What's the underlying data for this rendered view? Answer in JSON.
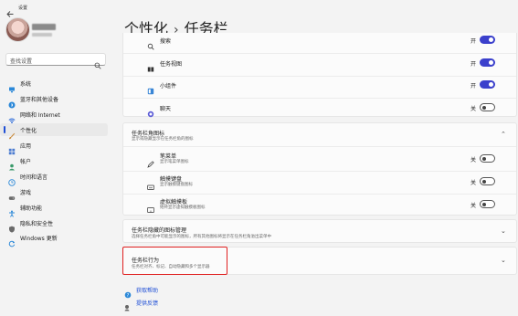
{
  "app": {
    "title": "设置"
  },
  "search": {
    "placeholder": "查找设置"
  },
  "sidebar": {
    "items": [
      {
        "label": "系统",
        "icon": "monitor-icon",
        "color": "#2b88d8"
      },
      {
        "label": "蓝牙和其他设备",
        "icon": "bluetooth-icon",
        "color": "#2b88d8"
      },
      {
        "label": "网络和 Internet",
        "icon": "wifi-icon",
        "color": "#2b6ad8"
      },
      {
        "label": "个性化",
        "icon": "brush-icon",
        "color": "#c98a3a",
        "active": true
      },
      {
        "label": "应用",
        "icon": "apps-icon",
        "color": "#4a7bd0"
      },
      {
        "label": "帐户",
        "icon": "person-icon",
        "color": "#3a9a6a"
      },
      {
        "label": "时间和语言",
        "icon": "globe-clock-icon",
        "color": "#2b88d8"
      },
      {
        "label": "游戏",
        "icon": "gamepad-icon",
        "color": "#6a6a6a"
      },
      {
        "label": "辅助功能",
        "icon": "accessibility-icon",
        "color": "#2b88d8"
      },
      {
        "label": "隐私和安全性",
        "icon": "shield-icon",
        "color": "#6a6a6a"
      },
      {
        "label": "Windows 更新",
        "icon": "update-icon",
        "color": "#2b88d8"
      }
    ]
  },
  "header": {
    "crumb1": "个性化",
    "crumb2": "任务栏"
  },
  "taskbar_items": [
    {
      "label": "搜索",
      "state": "开",
      "on": true
    },
    {
      "label": "任务视图",
      "state": "开",
      "on": true
    },
    {
      "label": "小组件",
      "state": "开",
      "on": true
    },
    {
      "label": "聊天",
      "state": "关",
      "on": false
    }
  ],
  "corner_icons": {
    "title": "任务栏角图标",
    "subtitle": "显示或隐藏显示在任务栏角的图标",
    "items": [
      {
        "label": "笔菜单",
        "sub": "显示笔菜单图标",
        "state": "关"
      },
      {
        "label": "触摸键盘",
        "sub": "显示触摸键盘图标",
        "state": "关"
      },
      {
        "label": "虚拟触摸板",
        "sub": "始终显示虚拟触摸板图标",
        "state": "关"
      }
    ]
  },
  "overflow": {
    "title": "任务栏隐藏的图标管理",
    "subtitle": "选择任务栏角中可能显示的图标，所有其他图标将显示在任务栏角溢出菜单中"
  },
  "behaviors": {
    "title": "任务栏行为",
    "subtitle": "任务栏对齐、标记、自动隐藏和多个显示器"
  },
  "links": {
    "help": "获取帮助",
    "feedback": "提供反馈"
  },
  "colors": {
    "accent": "#3b40cc",
    "highlight": "#e02020"
  }
}
